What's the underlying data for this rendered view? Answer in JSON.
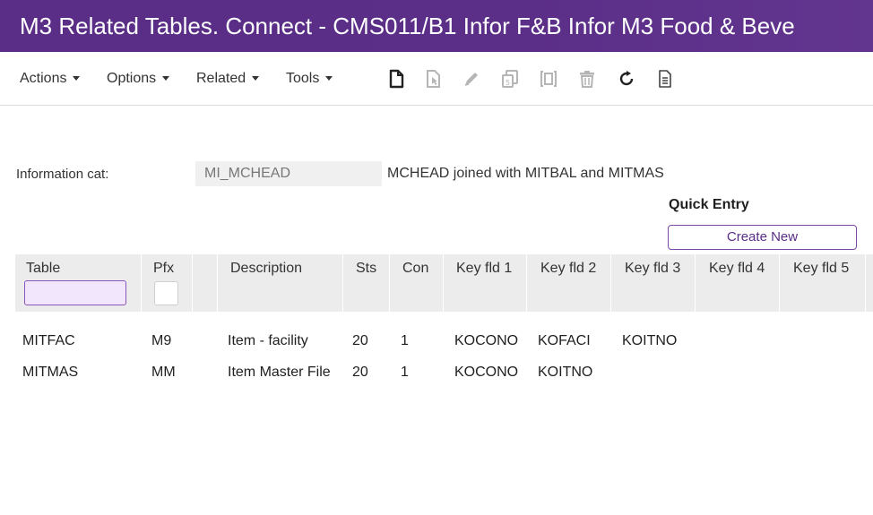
{
  "window": {
    "title": "M3 Related Tables. Connect - CMS011/B1   Infor F&B Infor M3 Food & Beve"
  },
  "toolbar": {
    "menus": [
      {
        "label": "Actions"
      },
      {
        "label": "Options"
      },
      {
        "label": "Related"
      },
      {
        "label": "Tools"
      }
    ],
    "icons": [
      "new-icon",
      "open-icon",
      "edit-icon",
      "copy-icon",
      "display-icon",
      "delete-icon",
      "refresh-icon",
      "document-icon"
    ]
  },
  "form": {
    "info_cat_label": "Information cat:",
    "info_cat_value": "MI_MCHEAD",
    "info_cat_description": "MCHEAD joined with MITBAL and MITMAS"
  },
  "quick_entry": {
    "title": "Quick Entry",
    "create_label": "Create New"
  },
  "grid": {
    "columns": [
      "Table",
      "Pfx",
      "",
      "Description",
      "Sts",
      "Con",
      "Key fld 1",
      "Key fld 2",
      "Key fld 3",
      "Key fld 4",
      "Key fld 5"
    ],
    "rows": [
      {
        "table": "MITFAC",
        "pfx": "M9",
        "description": "Item - facility",
        "sts": "20",
        "con": "1",
        "key1": "KOCONO",
        "key2": "KOFACI",
        "key3": "KOITNO",
        "key4": "",
        "key5": ""
      },
      {
        "table": "MITMAS",
        "pfx": "MM",
        "description": "Item Master File",
        "sts": "20",
        "con": "1",
        "key1": "KOCONO",
        "key2": "KOITNO",
        "key3": "",
        "key4": "",
        "key5": ""
      }
    ]
  },
  "colors": {
    "title_bar": "#5a2d86",
    "accent": "#7b4aa8",
    "filter_bg": "#f1e6fb",
    "grid_header": "#ececec"
  }
}
